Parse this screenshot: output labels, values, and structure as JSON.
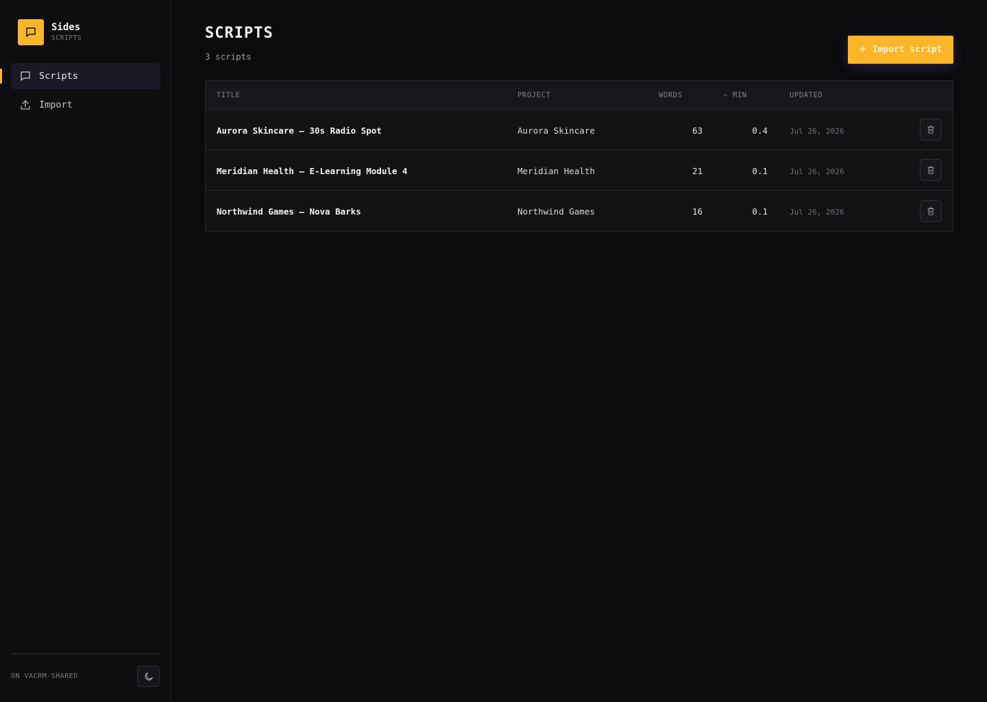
{
  "brand": {
    "name": "Sides",
    "subtitle": "SCRIPTS",
    "icon": "chat-bubble-icon",
    "color": "#fbb629"
  },
  "sidebar": {
    "items": [
      {
        "label": "Scripts",
        "icon": "chat-bubble-icon",
        "active": true
      },
      {
        "label": "Import",
        "icon": "upload-icon",
        "active": false
      }
    ],
    "footer": {
      "env_label": "ON VACRM-SHARED",
      "theme_icon": "moon-icon"
    }
  },
  "header": {
    "title": "SCRIPTS",
    "count": "3 scripts",
    "import_button": {
      "label": "Import script",
      "icon": "plus-icon"
    }
  },
  "table": {
    "columns": {
      "title": "TITLE",
      "project": "PROJECT",
      "words": "WORDS",
      "min": "~ MIN",
      "updated": "UPDATED"
    },
    "rows": [
      {
        "title": "Aurora Skincare — 30s Radio Spot",
        "project": "Aurora Skincare",
        "words": "63",
        "min": "0.4",
        "updated": "Jul 26, 2026"
      },
      {
        "title": "Meridian Health — E-Learning Module 4",
        "project": "Meridian Health",
        "words": "21",
        "min": "0.1",
        "updated": "Jul 26, 2026"
      },
      {
        "title": "Northwind Games — Nova Barks",
        "project": "Northwind Games",
        "words": "16",
        "min": "0.1",
        "updated": "Jul 26, 2026"
      }
    ],
    "row_action_icon": "trash-icon"
  },
  "colors": {
    "accent": "#fbb629",
    "background": "#0a0b0d",
    "sidebar": "#0d0e10",
    "active_nav": "#1c1826"
  }
}
